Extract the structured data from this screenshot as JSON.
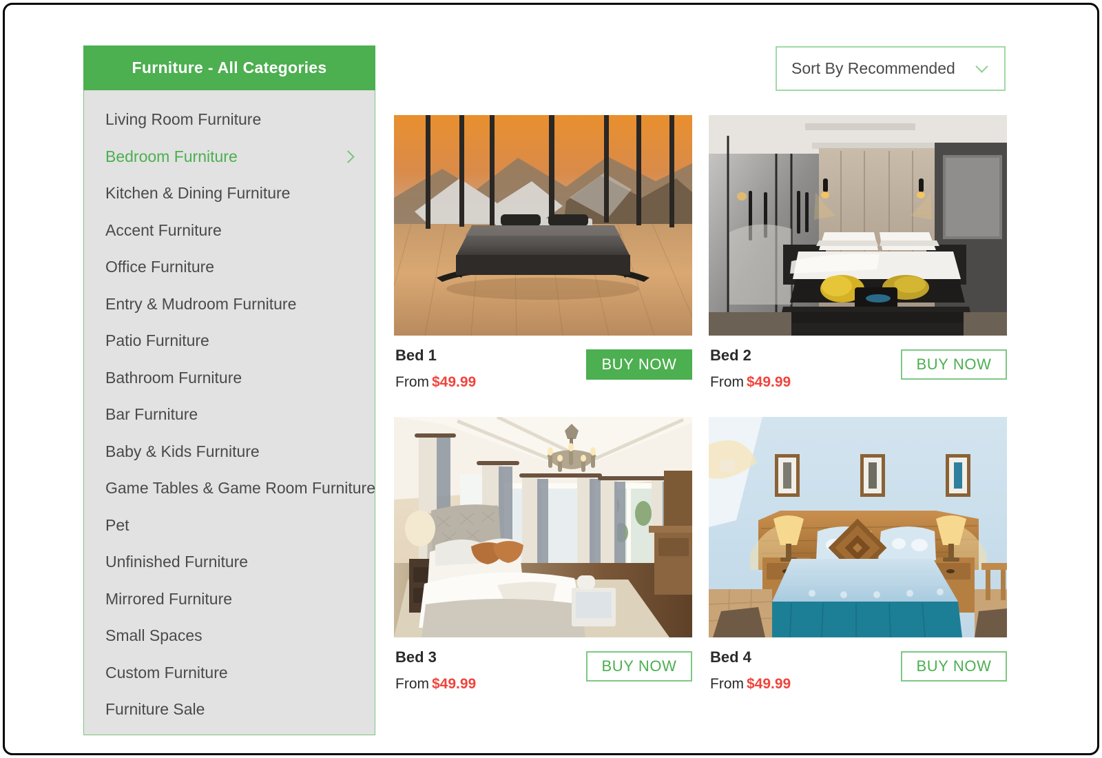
{
  "sidebar": {
    "header_title": "Furniture - All Categories",
    "items": [
      {
        "label": "Living Room Furniture",
        "active": false,
        "has_chevron": false
      },
      {
        "label": "Bedroom Furniture",
        "active": true,
        "has_chevron": true
      },
      {
        "label": "Kitchen & Dining Furniture",
        "active": false,
        "has_chevron": false
      },
      {
        "label": "Accent Furniture",
        "active": false,
        "has_chevron": false
      },
      {
        "label": "Office Furniture",
        "active": false,
        "has_chevron": false
      },
      {
        "label": "Entry & Mudroom Furniture",
        "active": false,
        "has_chevron": false
      },
      {
        "label": "Patio Furniture",
        "active": false,
        "has_chevron": false
      },
      {
        "label": "Bathroom Furniture",
        "active": false,
        "has_chevron": false
      },
      {
        "label": "Bar Furniture",
        "active": false,
        "has_chevron": false
      },
      {
        "label": "Baby & Kids Furniture",
        "active": false,
        "has_chevron": false
      },
      {
        "label": "Game Tables & Game Room Furniture",
        "active": false,
        "has_chevron": false
      },
      {
        "label": "Pet",
        "active": false,
        "has_chevron": false
      },
      {
        "label": "Unfinished Furniture",
        "active": false,
        "has_chevron": false
      },
      {
        "label": "Mirrored Furniture",
        "active": false,
        "has_chevron": false
      },
      {
        "label": "Small Spaces",
        "active": false,
        "has_chevron": false
      },
      {
        "label": "Custom Furniture",
        "active": false,
        "has_chevron": false
      },
      {
        "label": "Furniture Sale",
        "active": false,
        "has_chevron": false
      }
    ]
  },
  "sort": {
    "selected_label": "Sort By Recommended",
    "chevron_icon": "chevron-down-icon"
  },
  "products": [
    {
      "title": "Bed 1",
      "price_prefix": "From",
      "price": "$49.99",
      "buy_label": "BUY NOW",
      "buy_style": "filled",
      "image_name": "modern-platform-bed-mountain-view"
    },
    {
      "title": "Bed 2",
      "price_prefix": "From",
      "price": "$49.99",
      "buy_label": "BUY NOW",
      "buy_style": "outline",
      "image_name": "luxury-hotel-bedroom-mirrored-wardrobe"
    },
    {
      "title": "Bed 3",
      "price_prefix": "From",
      "price": "$49.99",
      "buy_label": "BUY NOW",
      "buy_style": "outline",
      "image_name": "traditional-master-bedroom-chandelier"
    },
    {
      "title": "Bed 4",
      "price_prefix": "From",
      "price": "$49.99",
      "buy_label": "BUY NOW",
      "buy_style": "outline",
      "image_name": "rustic-wood-bed-blue-bedding"
    }
  ],
  "colors": {
    "brand_green": "#4caf50",
    "border_green": "#7bc47f",
    "price_red": "#f0443c",
    "sidebar_bg": "#e2e2e2",
    "text_gray": "#4a4a4a"
  }
}
